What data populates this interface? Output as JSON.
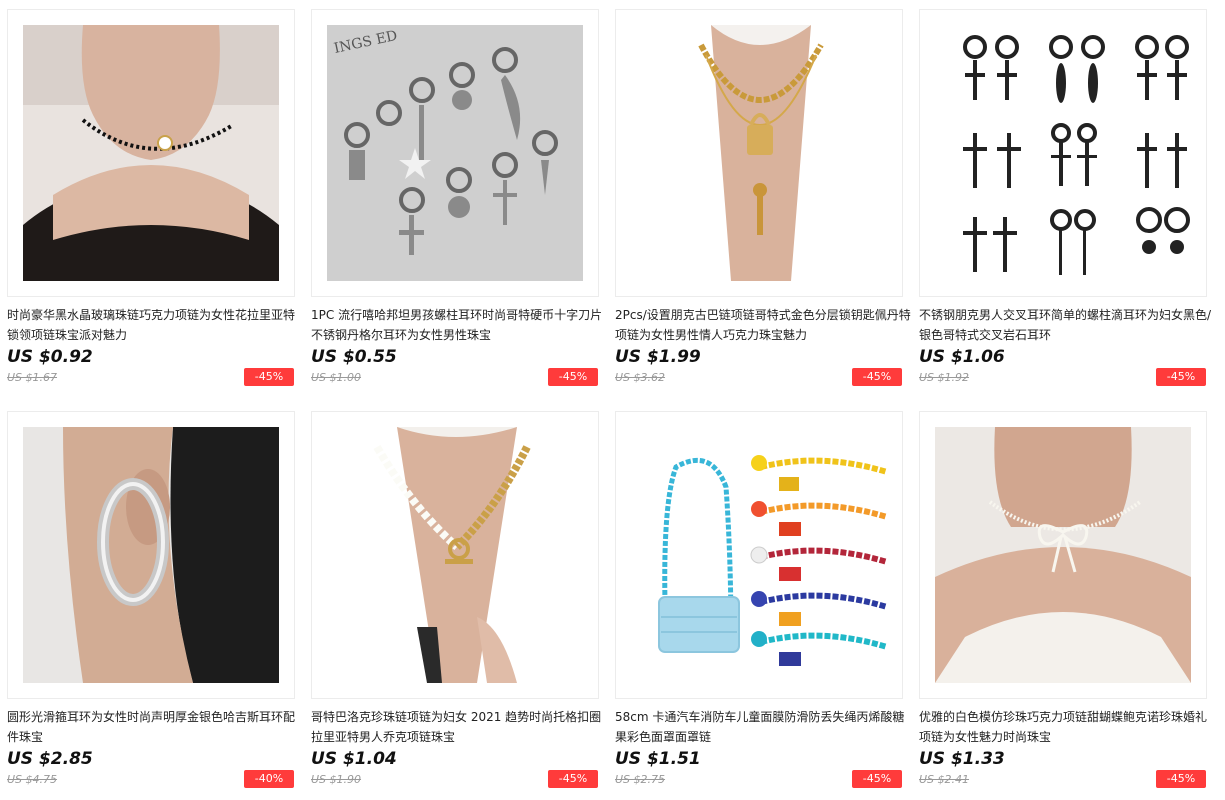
{
  "products": [
    {
      "title": "时尚豪华黑水晶玻璃珠链巧克力项链为女性花拉里亚特锁领项链珠宝派对魅力",
      "price": "US $0.92",
      "original_price": "US $1.67",
      "discount": "-45%",
      "image": "black-bead-choker-photo"
    },
    {
      "title": "1PC 流行嘻哈邦坦男孩螺柱耳环时尚哥特硬币十字刀片不锈钢丹格尔耳环为女性男性珠宝",
      "price": "US $0.55",
      "original_price": "US $1.00",
      "discount": "-45%",
      "image": "silver-charm-earrings-photo"
    },
    {
      "title": "2Pcs/设置朋克古巴链项链哥特式金色分层锁钥匙佩丹特项链为女性男性情人巧克力珠宝魅力",
      "price": "US $1.99",
      "original_price": "US $3.62",
      "discount": "-45%",
      "image": "gold-lock-key-necklace-photo"
    },
    {
      "title": "不锈钢朋克男人交叉耳环简单的螺柱滴耳环为妇女黑色/银色哥特式交叉岩石耳环",
      "price": "US $1.06",
      "original_price": "US $1.92",
      "discount": "-45%",
      "image": "black-cross-earrings-photo"
    },
    {
      "title": "圆形光滑箍耳环为女性时尚声明厚金银色哈吉斯耳环配件珠宝",
      "price": "US $2.85",
      "original_price": "US $4.75",
      "discount": "-40%",
      "image": "silver-hoop-earring-photo"
    },
    {
      "title": "哥特巴洛克珍珠链项链为妇女 2021 趋势时尚托格扣圈拉里亚特男人乔克项链珠宝",
      "price": "US $1.04",
      "original_price": "US $1.90",
      "discount": "-45%",
      "image": "pearl-gold-chain-necklace-photo"
    },
    {
      "title": "58cm 卡通汽车消防车儿童面膜防滑防丢失绳丙烯酸糖果彩色面罩面罩链",
      "price": "US $1.51",
      "original_price": "US $2.75",
      "discount": "-45%",
      "image": "colorful-mask-chains-photo"
    },
    {
      "title": "优雅的白色模仿珍珠巧克力项链甜蝴蝶鲍克诺珍珠婚礼项链为女性魅力时尚珠宝",
      "price": "US $1.33",
      "original_price": "US $2.41",
      "discount": "-45%",
      "image": "pearl-bow-choker-photo"
    }
  ]
}
